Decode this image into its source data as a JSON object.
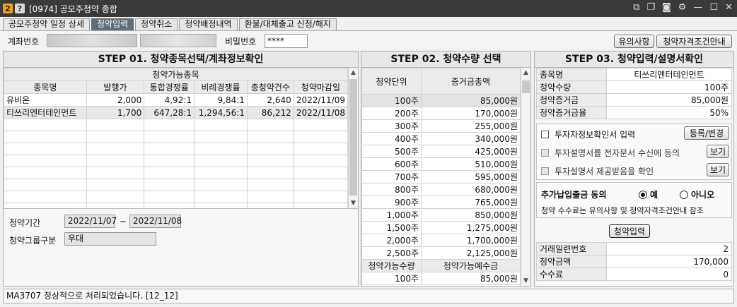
{
  "window": {
    "badge_num": "2",
    "badge_help": "?",
    "title": "[0974] 공모주청약 종합",
    "controls": [
      "new-window-icon",
      "copy-icon",
      "camera-icon",
      "gear-icon",
      "minimize-icon",
      "maximize-icon",
      "close-icon"
    ]
  },
  "tabs": [
    {
      "label": "공모주청약 일정 상세"
    },
    {
      "label": "청약입력"
    },
    {
      "label": "청약취소"
    },
    {
      "label": "청약배정내역"
    },
    {
      "label": "환불/대체출고 신청/해지"
    }
  ],
  "account": {
    "label": "계좌번호",
    "password_label": "비밀번호",
    "password_value": "****",
    "notice_button": "유의사항",
    "qualify_button": "청약자격조건안내"
  },
  "step1": {
    "title": "STEP 01. 청약종목선택/계좌정보확인",
    "group_header": "청약가능종목",
    "columns": [
      "종목명",
      "발행가",
      "통합경쟁률",
      "비례경쟁률",
      "총청약건수",
      "청약마감일"
    ],
    "rows": [
      [
        "유비온",
        "2,000",
        "4,92:1",
        "9,84:1",
        "2,640",
        "2022/11/09"
      ],
      [
        "티쓰리엔터테인먼트",
        "1,700",
        "647,28:1",
        "1,294,56:1",
        "86,212",
        "2022/11/08"
      ]
    ],
    "period_label": "청약기간",
    "period_start": "2022/11/07",
    "period_sep": "~",
    "period_end": "2022/11/08",
    "group_label": "청약그룹구분",
    "group_value": "우대"
  },
  "step2": {
    "title": "STEP 02. 청약수량 선택",
    "col_unit": "청약단위",
    "col_deposit": "증거금총액",
    "rows": [
      [
        "100주",
        "85,000원"
      ],
      [
        "200주",
        "170,000원"
      ],
      [
        "300주",
        "255,000원"
      ],
      [
        "400주",
        "340,000원"
      ],
      [
        "500주",
        "425,000원"
      ],
      [
        "600주",
        "510,000원"
      ],
      [
        "700주",
        "595,000원"
      ],
      [
        "800주",
        "680,000원"
      ],
      [
        "900주",
        "765,000원"
      ],
      [
        "1,000주",
        "850,000원"
      ],
      [
        "1,500주",
        "1,275,000원"
      ],
      [
        "2,000주",
        "1,700,000원"
      ],
      [
        "2,500주",
        "2,125,000원"
      ]
    ],
    "avail_qty_label": "청약가능수량",
    "avail_cash_label": "청약가능예수금",
    "avail_qty": "100주",
    "avail_cash": "85,000원"
  },
  "step3": {
    "title": "STEP 03. 청약입력/설명서확인",
    "fields": [
      {
        "label": "종목명",
        "value": "티쓰리엔터테인먼트"
      },
      {
        "label": "청약수량",
        "value": "100주"
      },
      {
        "label": "청약증거금",
        "value": "85,000원"
      },
      {
        "label": "청약증거금율",
        "value": "50%"
      }
    ],
    "check_info": "투자자정보확인서 입력",
    "register_button": "등록/변경",
    "check_electronic": "투자설명서를 전자문서 수신에 동의",
    "check_received": "투자설명서 제공받음을 확인",
    "view_button": "보기",
    "extra_label": "추가납입출금 동의",
    "radio_yes": "예",
    "radio_no": "아니오",
    "fee_note": "청약 수수료는 유의사항 및 청약자격조건안내 참조",
    "submit_button": "청약입력",
    "results": [
      {
        "label": "거래일련번호",
        "value": "2"
      },
      {
        "label": "청약금액",
        "value": "170,000"
      },
      {
        "label": "수수료",
        "value": "0"
      }
    ]
  },
  "status": {
    "message": "MA3707 정상적으로 처리되었습니다. [12_12]"
  }
}
